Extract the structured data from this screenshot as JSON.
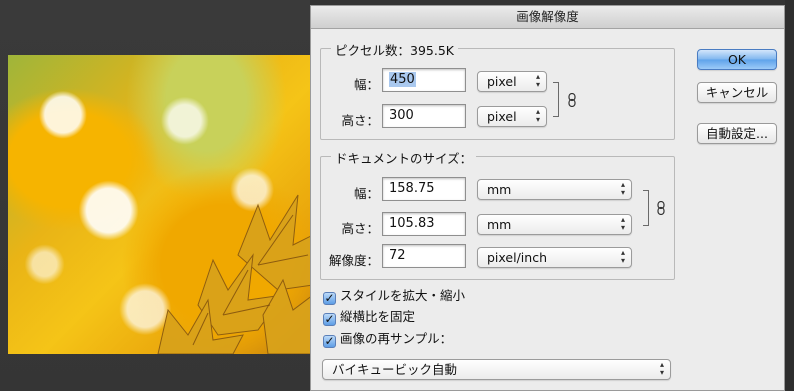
{
  "dialog": {
    "title": "画像解像度",
    "pixel_dimensions": {
      "title": "ピクセル数：395.5K",
      "width": {
        "label": "幅：",
        "value": "450",
        "unit": "pixel"
      },
      "height": {
        "label": "高さ：",
        "value": "300",
        "unit": "pixel"
      }
    },
    "document_size": {
      "title": "ドキュメントのサイズ：",
      "width": {
        "label": "幅：",
        "value": "158.75",
        "unit": "mm"
      },
      "height": {
        "label": "高さ：",
        "value": "105.83",
        "unit": "mm"
      },
      "resolution": {
        "label": "解像度：",
        "value": "72",
        "unit": "pixel/inch"
      }
    },
    "checkboxes": {
      "scale_styles": {
        "label": "スタイルを拡大・縮小",
        "checked": true
      },
      "constrain_proportions": {
        "label": "縦横比を固定",
        "checked": true
      },
      "resample": {
        "label": "画像の再サンプル：",
        "checked": true
      }
    },
    "resample_method": "バイキュービック自動",
    "buttons": {
      "ok": "OK",
      "cancel": "キャンセル",
      "auto": "自動設定..."
    }
  },
  "colors": {
    "accent": "#5ea2ea",
    "dialog_bg": "#ececec",
    "app_bg": "#333333"
  }
}
